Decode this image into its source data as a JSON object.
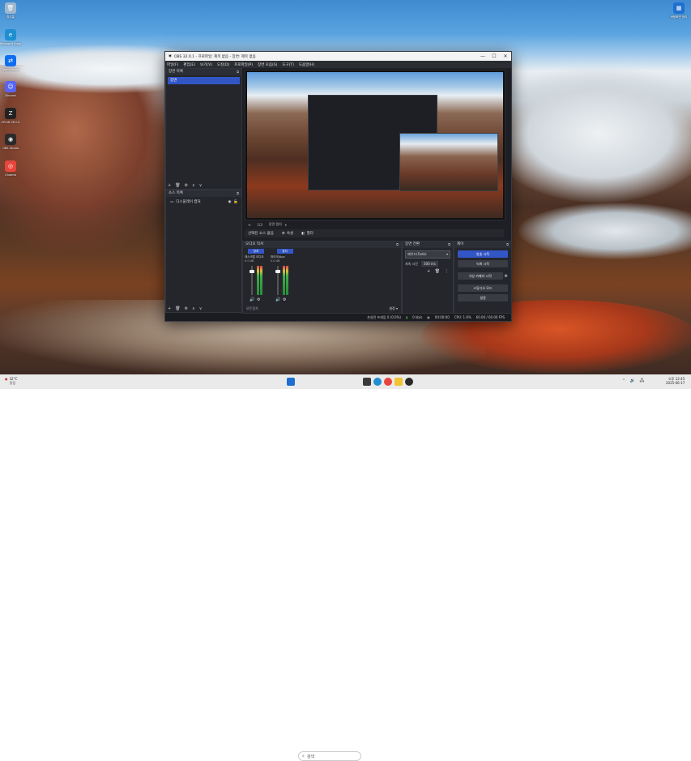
{
  "desktop": {
    "icons": [
      {
        "label": "휴지통",
        "icon": "recycle-bin-icon",
        "color": "#9fb8cf",
        "glyph": "🗑"
      },
      {
        "label": "Microsoft Edge",
        "icon": "edge-icon",
        "color": "#1f8fd1",
        "glyph": "e"
      },
      {
        "label": "TeamViewer",
        "icon": "teamviewer-icon",
        "color": "#0e6ef0",
        "glyph": "⇄"
      },
      {
        "label": "Discord",
        "icon": "discord-icon",
        "color": "#5865f2",
        "glyph": "☺"
      },
      {
        "label": "CPUID CPU-Z",
        "icon": "cpuz-icon",
        "color": "#222",
        "glyph": "Z"
      },
      {
        "label": "OBS Studio",
        "icon": "obs-icon",
        "color": "#2a2a2a",
        "glyph": "◉"
      },
      {
        "label": "Chrome",
        "icon": "chrome-icon",
        "color": "#e8453c",
        "glyph": "◎"
      }
    ],
    "right_icon": {
      "label": "바탕화면 정리",
      "icon": "app-icon",
      "color": "#1f6fd1",
      "glyph": "▦"
    }
  },
  "obs": {
    "title": "OBS 32.0.1 - 프로파일: 제목 없음 - 장면: 제목 없음",
    "window_buttons": {
      "minimize": "—",
      "maximize": "☐",
      "close": "✕"
    },
    "menu": [
      "파일(F)",
      "편집(E)",
      "보기(V)",
      "도킹(D)",
      "프로파일(P)",
      "장면 모음(S)",
      "도구(T)",
      "도움말(H)"
    ],
    "scenes": {
      "title": "장면 목록",
      "items": [
        "장면"
      ]
    },
    "sources": {
      "title": "소스 목록",
      "items": [
        "디스플레이 캡처"
      ]
    },
    "toolbar_glyphs": [
      "+",
      "🗑",
      "⚙",
      "∧",
      "∨"
    ],
    "transport": [
      "⟲",
      "1/3",
      "장면 캡처"
    ],
    "source_bar": {
      "label": "선택된 소스 없음",
      "props": "속성",
      "filters": "필터"
    },
    "mixer": {
      "title": "오디오 믹서",
      "tabs": [
        "장치",
        "장치"
      ],
      "channels": [
        {
          "name": "데스크탑 오디오",
          "level": "0.0 dB"
        },
        {
          "name": "마이크/Aux",
          "level": "0.0 dB"
        }
      ],
      "footer_left": "모든장치",
      "footer_right": "설정"
    },
    "transitions": {
      "title": "장면 전환",
      "type": "페이드(Fade)",
      "duration_label": "지속 시간",
      "duration": "300 ms"
    },
    "controls": {
      "title": "제어",
      "buttons": [
        "방송 시작",
        "녹화 시작",
        "가상 카메라 시작",
        "스튜디오 모드",
        "설정"
      ]
    },
    "status": {
      "dropped": "손실된 프레임 0 (0.0%)",
      "bitrate": "0 kb/s",
      "time": "00:00:00",
      "cpu": "CPU: 1.6%",
      "fps": "60.00 / 60.00 FPS"
    }
  },
  "taskbar": {
    "weather": {
      "temp": "32°C",
      "desc": "맑음"
    },
    "search_placeholder": "검색",
    "apps": [
      {
        "icon": "start-icon",
        "color": "#1f6fd1"
      },
      {
        "icon": "file-explorer-icon",
        "color": "#f2c230"
      },
      {
        "icon": "edge-icon",
        "color": "#1f8fd1"
      },
      {
        "icon": "chrome-icon",
        "color": "#e8453c"
      },
      {
        "icon": "store-icon",
        "color": "#3a3a3a"
      },
      {
        "icon": "obs-icon",
        "color": "#2a2a2a"
      }
    ],
    "clock": {
      "time": "오후 12:45",
      "date": "2025-06-17"
    },
    "tray": [
      "⌃",
      "🔊",
      "🖧"
    ]
  }
}
